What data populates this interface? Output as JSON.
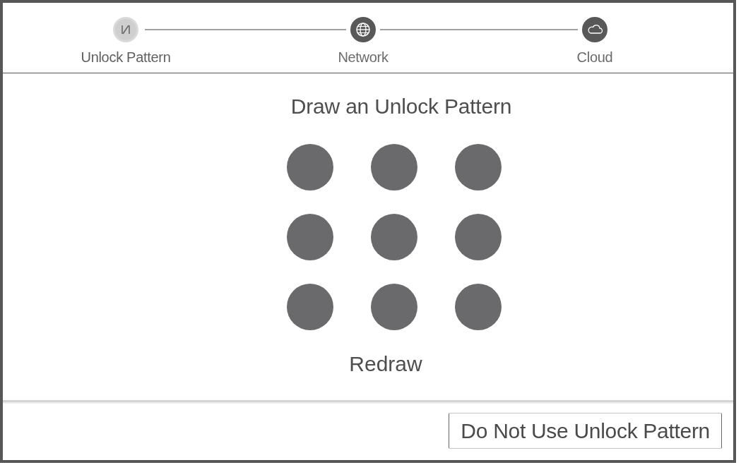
{
  "steps": [
    {
      "label": "Unlock Pattern",
      "current": true
    },
    {
      "label": "Network",
      "current": false
    },
    {
      "label": "Cloud",
      "current": false
    }
  ],
  "pattern": {
    "title": "Draw an Unlock Pattern",
    "dots": [
      {
        "selected": false
      },
      {
        "selected": false
      },
      {
        "selected": false
      },
      {
        "selected": false
      },
      {
        "selected": false
      },
      {
        "selected": false
      },
      {
        "selected": false
      },
      {
        "selected": false
      },
      {
        "selected": false
      }
    ],
    "redraw": "Redraw"
  },
  "footer": {
    "button": "Do Not Use Unlock Pattern"
  }
}
